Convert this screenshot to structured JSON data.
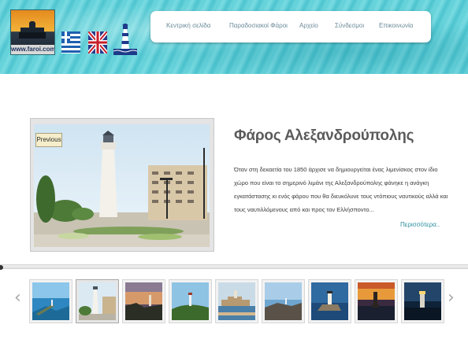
{
  "header": {
    "logo_text": "www.faroi.com",
    "nav": [
      {
        "label": "Κεντρική σελίδα"
      },
      {
        "label": "Παραδοσιακοί Φάροι"
      },
      {
        "label": "Αρχείο"
      },
      {
        "label": "Σύνδεσμοι"
      },
      {
        "label": "Επικοινωνία"
      }
    ]
  },
  "slider": {
    "previous_label": "Previous"
  },
  "article": {
    "title": "Φάρος Αλεξανδρούπολης",
    "description": "Όταν στη δεκαετία του 1850 άρχισε να δημιουργείται ένας λιμενίσκος στον ίδιο χώρο που είναι το σημερινό λιμάνι της Αλεξανδρούπολης φάνηκε η ανάγκη εγκατάστασης κι ενός φάρου που θα διευκόλυνε τους ντόπιους ναυτικούς αλλά και τους ναυτιλλόμενους από και προς τον Ελλήσποντο...",
    "more_label": "Περισσότερα.."
  },
  "carousel": {
    "left_arrow": "‹",
    "right_arrow": "›"
  },
  "colors": {
    "header_sea": "#5fcfd8",
    "link": "#2b8fa0",
    "title": "#5a5a5a"
  }
}
